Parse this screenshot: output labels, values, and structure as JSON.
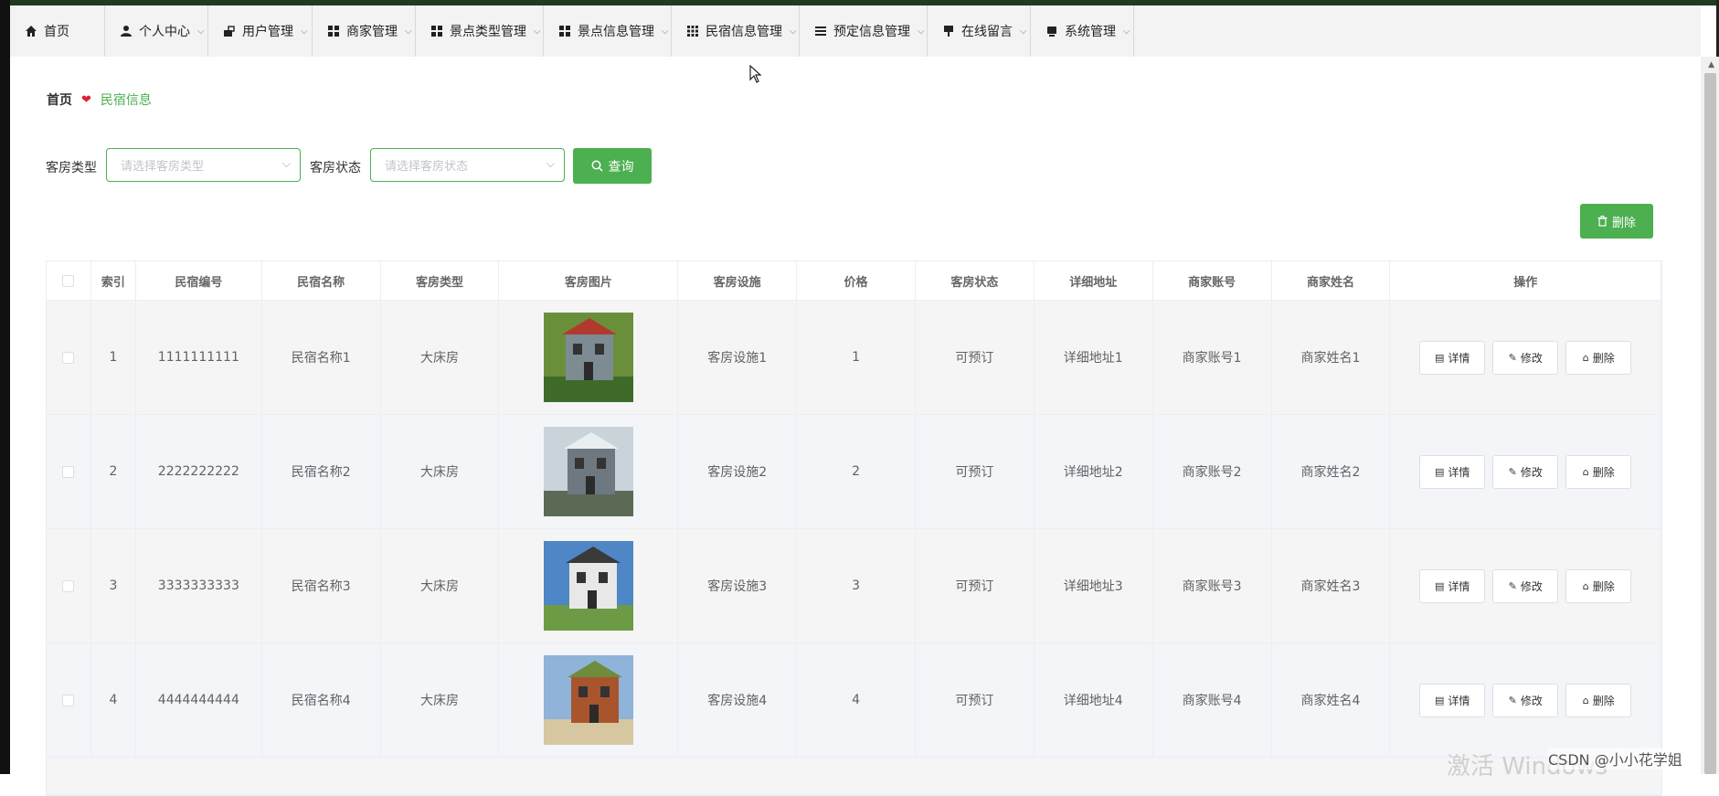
{
  "nav": {
    "items": [
      {
        "label": "首页",
        "icon": "home-icon",
        "dropdown": false
      },
      {
        "label": "个人中心",
        "icon": "user-icon",
        "dropdown": true
      },
      {
        "label": "用户管理",
        "icon": "users-icon",
        "dropdown": true
      },
      {
        "label": "商家管理",
        "icon": "grid-icon",
        "dropdown": true
      },
      {
        "label": "景点类型管理",
        "icon": "grid-icon",
        "dropdown": true
      },
      {
        "label": "景点信息管理",
        "icon": "grid-icon",
        "dropdown": true
      },
      {
        "label": "民宿信息管理",
        "icon": "grid-9-icon",
        "dropdown": true
      },
      {
        "label": "预定信息管理",
        "icon": "list-icon",
        "dropdown": true
      },
      {
        "label": "在线留言",
        "icon": "message-icon",
        "dropdown": true
      },
      {
        "label": "系统管理",
        "icon": "settings-icon",
        "dropdown": true
      }
    ]
  },
  "breadcrumb": {
    "home": "首页",
    "current": "民宿信息"
  },
  "filters": {
    "room_type_label": "客房类型",
    "room_type_placeholder": "请选择客房类型",
    "room_status_label": "客房状态",
    "room_status_placeholder": "请选择客房状态",
    "query_label": "查询",
    "delete_label": "删除"
  },
  "table": {
    "headers": [
      "",
      "索引",
      "民宿编号",
      "民宿名称",
      "客房类型",
      "客房图片",
      "客房设施",
      "价格",
      "客房状态",
      "详细地址",
      "商家账号",
      "商家姓名",
      "操作"
    ],
    "rows": [
      {
        "index": "1",
        "code": "1111111111",
        "name": "民宿名称1",
        "type": "大床房",
        "facility": "客房设施1",
        "price": "1",
        "status": "可预订",
        "address": "详细地址1",
        "account": "商家账号1",
        "merchant": "商家姓名1"
      },
      {
        "index": "2",
        "code": "2222222222",
        "name": "民宿名称2",
        "type": "大床房",
        "facility": "客房设施2",
        "price": "2",
        "status": "可预订",
        "address": "详细地址2",
        "account": "商家账号2",
        "merchant": "商家姓名2"
      },
      {
        "index": "3",
        "code": "3333333333",
        "name": "民宿名称3",
        "type": "大床房",
        "facility": "客房设施3",
        "price": "3",
        "status": "可预订",
        "address": "详细地址3",
        "account": "商家账号3",
        "merchant": "商家姓名3"
      },
      {
        "index": "4",
        "code": "4444444444",
        "name": "民宿名称4",
        "type": "大床房",
        "facility": "客房设施4",
        "price": "4",
        "status": "可预订",
        "address": "详细地址4",
        "account": "商家账号4",
        "merchant": "商家姓名4"
      }
    ],
    "actions": {
      "detail": "详情",
      "edit": "修改",
      "delete": "删除"
    }
  },
  "colors": {
    "accent": "#4caf50",
    "header_bar": "#1f3b22",
    "heart": "#e0202f"
  },
  "watermark": {
    "activate": "激活 Windows",
    "csdn": "CSDN @小小花学姐"
  }
}
